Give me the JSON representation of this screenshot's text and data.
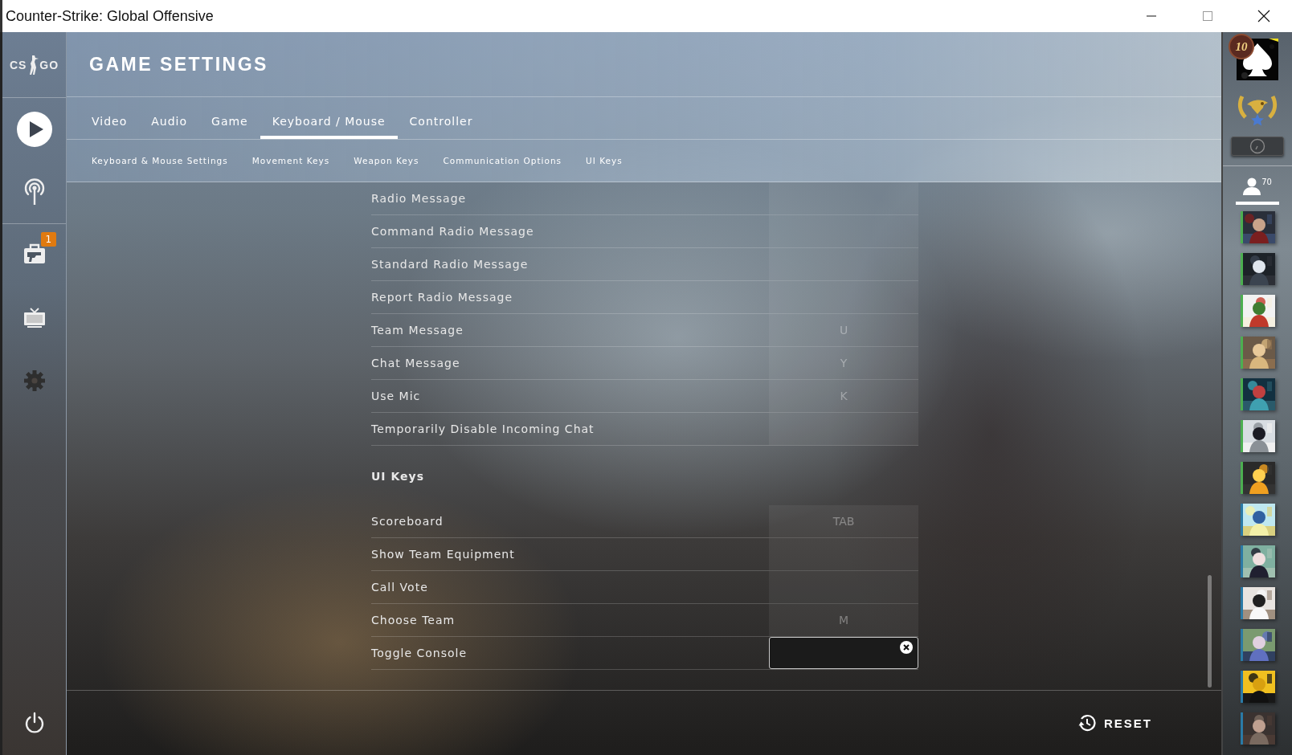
{
  "window": {
    "title": "Counter-Strike: Global Offensive"
  },
  "sidebar": {
    "items": [
      {
        "kind": "logo",
        "parts": [
          "CS",
          "GO"
        ]
      },
      {
        "kind": "play"
      },
      {
        "kind": "antenna"
      },
      {
        "kind": "inventory",
        "badge": "1"
      },
      {
        "kind": "tv"
      },
      {
        "kind": "settings"
      },
      {
        "kind": "power"
      }
    ]
  },
  "header": {
    "title": "GAME SETTINGS"
  },
  "tabs": [
    {
      "label": "Video",
      "selected": false
    },
    {
      "label": "Audio",
      "selected": false
    },
    {
      "label": "Game",
      "selected": false
    },
    {
      "label": "Keyboard / Mouse",
      "selected": true
    },
    {
      "label": "Controller",
      "selected": false
    }
  ],
  "subtabs": [
    "Keyboard & Mouse Settings",
    "Movement Keys",
    "Weapon Keys",
    "Communication Options",
    "UI Keys"
  ],
  "sections": [
    {
      "rows": [
        {
          "label": "Radio Message",
          "editing": false
        },
        {
          "label": "Command Radio Message",
          "editing": false
        },
        {
          "label": "Standard Radio Message",
          "editing": false
        },
        {
          "label": "Report Radio Message",
          "editing": false
        },
        {
          "label": "Team Message",
          "key": "U",
          "editing": false
        },
        {
          "label": "Chat Message",
          "key": "Y",
          "editing": false
        },
        {
          "label": "Use Mic",
          "key": "K",
          "editing": false
        },
        {
          "label": "Temporarily Disable Incoming Chat",
          "editing": false
        }
      ]
    },
    {
      "heading": "UI Keys",
      "rows": [
        {
          "label": "Scoreboard",
          "key": "TAB",
          "editing": false
        },
        {
          "label": "Show Team Equipment",
          "editing": false
        },
        {
          "label": "Call Vote",
          "editing": false
        },
        {
          "label": "Choose Team",
          "key": "M",
          "editing": false
        },
        {
          "label": "Toggle Console",
          "editing": true
        }
      ]
    }
  ],
  "footer": {
    "reset": "RESET"
  },
  "profile": {
    "level": "10",
    "friends_count": "70"
  }
}
